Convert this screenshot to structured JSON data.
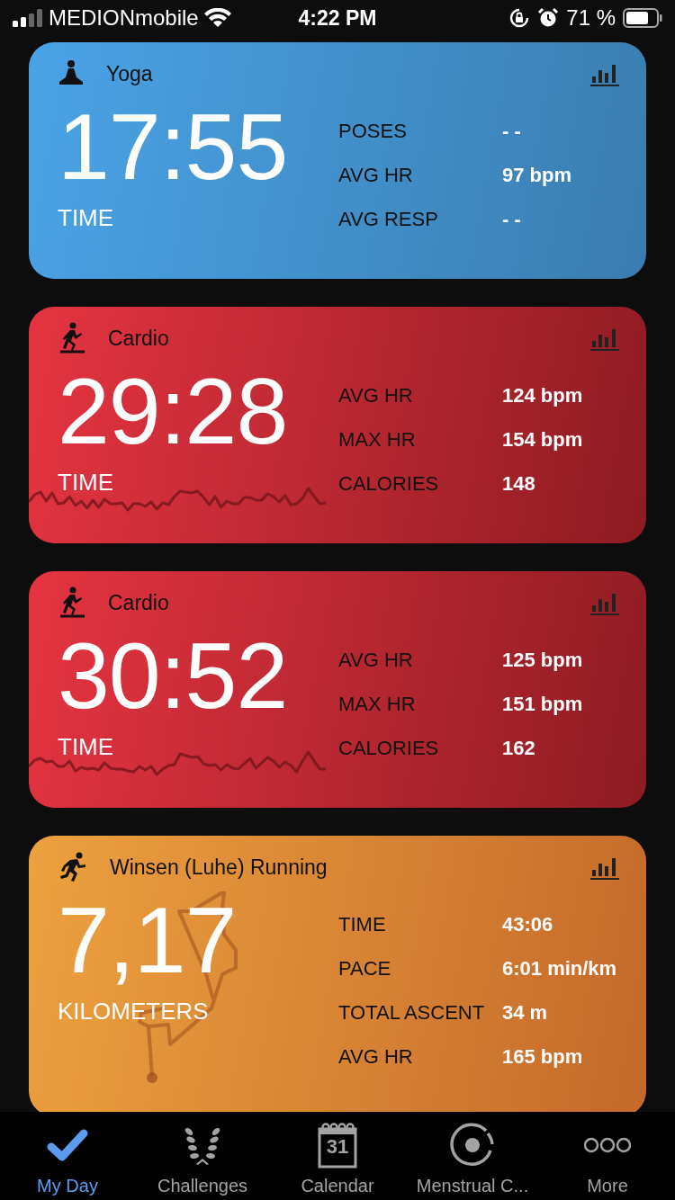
{
  "status_bar": {
    "carrier": "MEDIONmobile",
    "time": "4:22 PM",
    "battery": "71 %"
  },
  "activities": [
    {
      "kind": "yoga",
      "title": "Yoga",
      "value": "17:55",
      "unit": "TIME",
      "stats": [
        {
          "label": "POSES",
          "value": "- -"
        },
        {
          "label": "AVG HR",
          "value": "97 bpm"
        },
        {
          "label": "AVG RESP",
          "value": "- -"
        }
      ]
    },
    {
      "kind": "cardio",
      "title": "Cardio",
      "value": "29:28",
      "unit": "TIME",
      "stats": [
        {
          "label": "AVG HR",
          "value": "124 bpm"
        },
        {
          "label": "MAX HR",
          "value": "154 bpm"
        },
        {
          "label": "CALORIES",
          "value": "148"
        }
      ]
    },
    {
      "kind": "cardio",
      "title": "Cardio",
      "value": "30:52",
      "unit": "TIME",
      "stats": [
        {
          "label": "AVG HR",
          "value": "125 bpm"
        },
        {
          "label": "MAX HR",
          "value": "151 bpm"
        },
        {
          "label": "CALORIES",
          "value": "162"
        }
      ]
    },
    {
      "kind": "running",
      "title": "Winsen (Luhe) Running",
      "value": "7,17",
      "unit": "KILOMETERS",
      "stats": [
        {
          "label": "TIME",
          "value": "43:06"
        },
        {
          "label": "PACE",
          "value": "6:01 min/km"
        },
        {
          "label": "TOTAL ASCENT",
          "value": "34 m"
        },
        {
          "label": "AVG HR",
          "value": "165 bpm"
        }
      ]
    }
  ],
  "tabs": [
    {
      "kind": "check",
      "label": "My Day",
      "selected": true
    },
    {
      "kind": "laurel",
      "label": "Challenges",
      "selected": false
    },
    {
      "kind": "calendar",
      "label": "Calendar",
      "selected": false,
      "badge": "31"
    },
    {
      "kind": "cycle",
      "label": "Menstrual C...",
      "selected": false
    },
    {
      "kind": "more",
      "label": "More",
      "selected": false
    }
  ]
}
